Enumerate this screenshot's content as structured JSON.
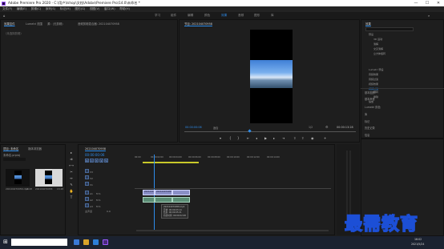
{
  "titlebar": {
    "title": "Adobe Premiere Pro 2020 - C:\\用户\\Ishop\\文档\\Adobe\\Premiere Pro\\14.0\\未命名 *",
    "min": "—",
    "max": "☐",
    "close": "✕"
  },
  "menu": [
    "文件(F)",
    "编辑(E)",
    "剪辑(C)",
    "序列(S)",
    "标记(M)",
    "图形(G)",
    "视图(V)",
    "窗口(W)",
    "帮助(H)"
  ],
  "workspaces": [
    {
      "label": "学习",
      "active": false
    },
    {
      "label": "组件",
      "active": false
    },
    {
      "label": "编辑",
      "active": false
    },
    {
      "label": "颜色",
      "active": false
    },
    {
      "label": "效果",
      "active": true
    },
    {
      "label": "音频",
      "active": false
    },
    {
      "label": "图形",
      "active": false
    },
    {
      "label": "库",
      "active": false
    }
  ],
  "source_panel": {
    "tabs": [
      "效果控件",
      "Lumetri 范围",
      "源：(无剪辑)",
      "音频剪辑混合器: 202104070958"
    ],
    "empty_text": "（未选择剪辑）"
  },
  "program_monitor": {
    "tab": "节目: 202104070958",
    "timecode_left": "00:00:00:06",
    "fit": "适合",
    "scale": "1/2",
    "timecode_right": "00:00:13:28"
  },
  "effects_panel": {
    "title": "效果",
    "tree": [
      "预设",
      "Lumetri 预设",
      "音频效果",
      "音频过渡",
      "视频效果",
      "视频过渡",
      "3D 运动",
      "溶解",
      "交叉溶解",
      "立方体旋转",
      "翻转",
      "擦除",
      "缩放"
    ],
    "sections": [
      "基本图形",
      "基本声音",
      "Lumetri 颜色",
      "库",
      "标记",
      "历史记录",
      "信息"
    ]
  },
  "project_panel": {
    "tabs": [
      "项目: 未命名",
      "媒体浏览器"
    ],
    "path": "未命名.prproj",
    "items": [
      {
        "name": "202104070958.mp4",
        "duration": "13:28"
      },
      {
        "name": "202104070958",
        "duration": "13:28"
      }
    ]
  },
  "timeline": {
    "tab": "202104070958",
    "timecode": "00:00:00:06",
    "ruler": [
      "00:00",
      "00:00:02:00",
      "00:00:04:00",
      "00:00:06:00",
      "00:00:08:00",
      "00:00:10:00",
      "00:00:12:00",
      "00:00:14:00"
    ],
    "video_tracks": [
      "V3",
      "V2",
      "V1"
    ],
    "audio_tracks": [
      "A1",
      "A2",
      "A3"
    ],
    "master": "主声道",
    "master_value": "0.0",
    "clips": [
      "202104070958.mp4",
      "202104070958.mp4",
      "202104070958.mp4"
    ],
    "tooltip": [
      "202104070958.mp4",
      "开始: 00:00:03:14",
      "结束: 00:00:05:21",
      "持续时间: 00:00:02:08"
    ]
  },
  "taskbar": {
    "time": "16:02",
    "date": "2021/5/24"
  },
  "watermark": "最需教育",
  "colors": {
    "accent": "#2d8ceb",
    "video_clip": "#8a8fc6",
    "audio_clip": "#5a8c74",
    "playhead": "#2d8ceb"
  }
}
